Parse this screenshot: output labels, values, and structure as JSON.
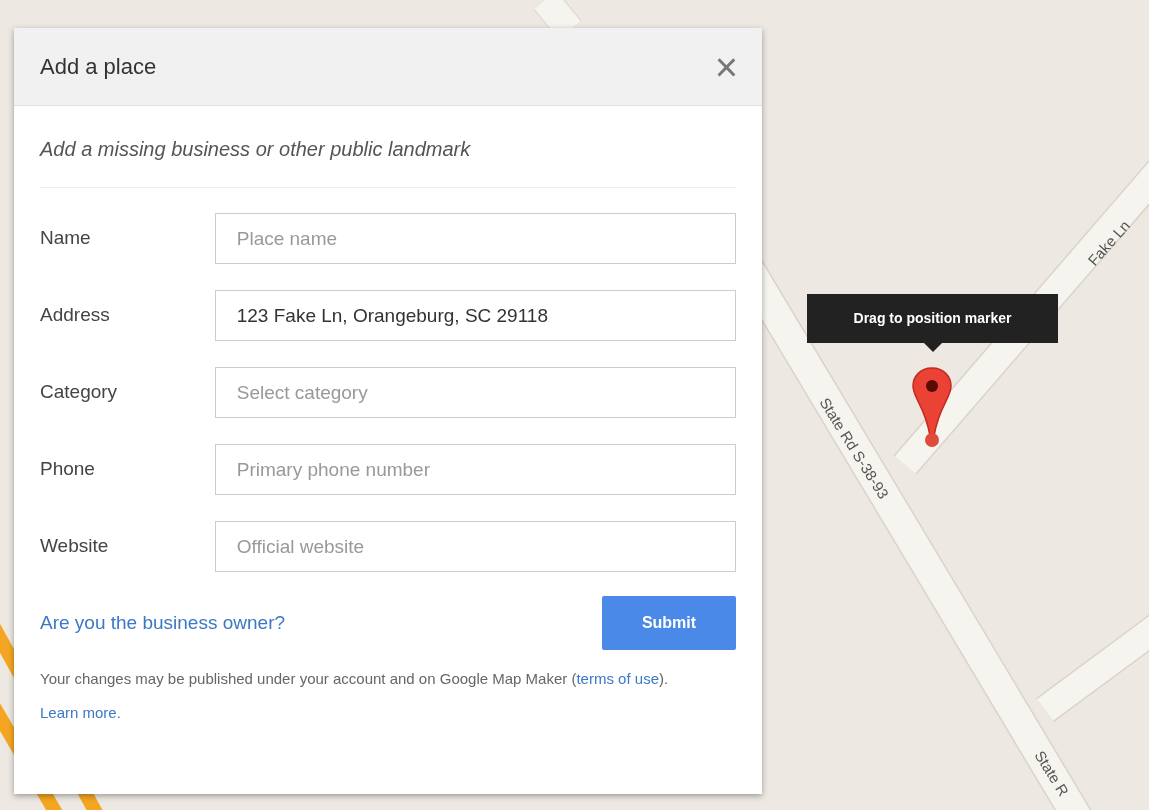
{
  "map": {
    "road_labels": [
      {
        "text": "Fake Ln",
        "kind": "fake"
      },
      {
        "text": "State Rd S-38-93",
        "kind": "state"
      },
      {
        "text": "State R",
        "kind": "state_lower"
      }
    ],
    "tooltip": "Drag to position marker"
  },
  "dialog": {
    "title": "Add a place",
    "close": "×",
    "subtitle": "Add a missing business or other public landmark",
    "fields": [
      {
        "label": "Name",
        "placeholder": "Place name"
      },
      {
        "label": "Address",
        "value": "123 Fake Ln, Orangeburg, SC 29118"
      },
      {
        "label": "Category",
        "placeholder": "Select category"
      },
      {
        "label": "Phone",
        "placeholder": "Primary phone number"
      },
      {
        "label": "Website",
        "placeholder": "Official website"
      }
    ],
    "owner_link": "Are you the business owner?",
    "submit": "Submit",
    "footer": {
      "text_before": "Your changes may be published under your account and on Google Map Maker (",
      "terms_link": "terms of use",
      "text_after": ").",
      "learn_more_link": "Learn more."
    }
  }
}
